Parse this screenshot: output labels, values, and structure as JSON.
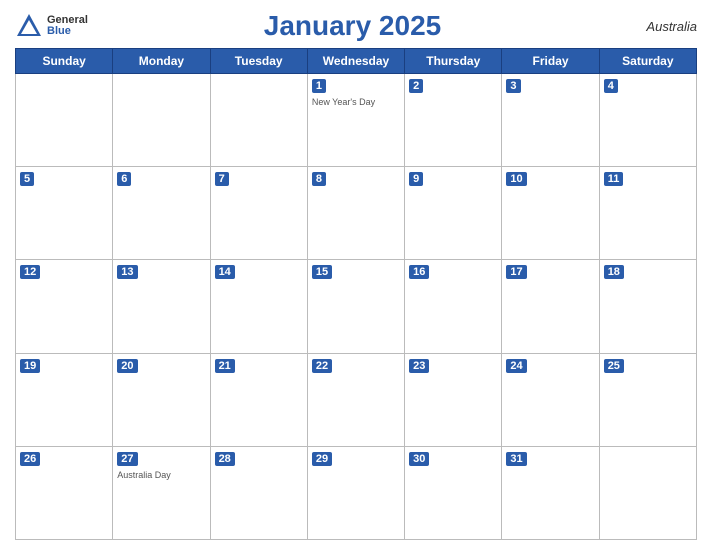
{
  "header": {
    "logo_general": "General",
    "logo_blue": "Blue",
    "month_year": "January 2025",
    "country": "Australia"
  },
  "days_of_week": [
    "Sunday",
    "Monday",
    "Tuesday",
    "Wednesday",
    "Thursday",
    "Friday",
    "Saturday"
  ],
  "weeks": [
    [
      {
        "num": "",
        "holiday": ""
      },
      {
        "num": "",
        "holiday": ""
      },
      {
        "num": "",
        "holiday": ""
      },
      {
        "num": "1",
        "holiday": "New Year's Day"
      },
      {
        "num": "2",
        "holiday": ""
      },
      {
        "num": "3",
        "holiday": ""
      },
      {
        "num": "4",
        "holiday": ""
      }
    ],
    [
      {
        "num": "5",
        "holiday": ""
      },
      {
        "num": "6",
        "holiday": ""
      },
      {
        "num": "7",
        "holiday": ""
      },
      {
        "num": "8",
        "holiday": ""
      },
      {
        "num": "9",
        "holiday": ""
      },
      {
        "num": "10",
        "holiday": ""
      },
      {
        "num": "11",
        "holiday": ""
      }
    ],
    [
      {
        "num": "12",
        "holiday": ""
      },
      {
        "num": "13",
        "holiday": ""
      },
      {
        "num": "14",
        "holiday": ""
      },
      {
        "num": "15",
        "holiday": ""
      },
      {
        "num": "16",
        "holiday": ""
      },
      {
        "num": "17",
        "holiday": ""
      },
      {
        "num": "18",
        "holiday": ""
      }
    ],
    [
      {
        "num": "19",
        "holiday": ""
      },
      {
        "num": "20",
        "holiday": ""
      },
      {
        "num": "21",
        "holiday": ""
      },
      {
        "num": "22",
        "holiday": ""
      },
      {
        "num": "23",
        "holiday": ""
      },
      {
        "num": "24",
        "holiday": ""
      },
      {
        "num": "25",
        "holiday": ""
      }
    ],
    [
      {
        "num": "26",
        "holiday": ""
      },
      {
        "num": "27",
        "holiday": "Australia Day"
      },
      {
        "num": "28",
        "holiday": ""
      },
      {
        "num": "29",
        "holiday": ""
      },
      {
        "num": "30",
        "holiday": ""
      },
      {
        "num": "31",
        "holiday": ""
      },
      {
        "num": "",
        "holiday": ""
      }
    ]
  ]
}
